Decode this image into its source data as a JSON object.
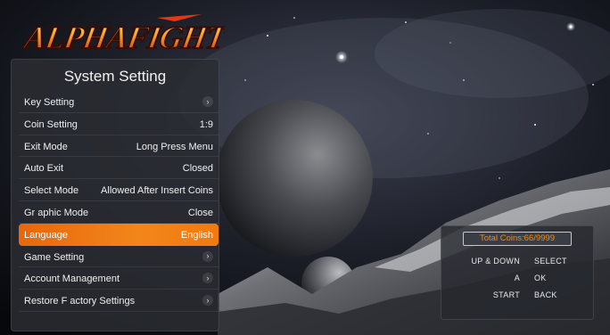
{
  "logo": {
    "text": "ALPHAFIGHT"
  },
  "panel": {
    "title": "System Setting",
    "items": [
      {
        "label": "Key Setting",
        "value": "",
        "arrow": true,
        "active": false
      },
      {
        "label": "Coin Setting",
        "value": "1:9",
        "arrow": false,
        "active": false
      },
      {
        "label": "Exit Mode",
        "value": "Long Press Menu",
        "arrow": false,
        "active": false
      },
      {
        "label": "Auto Exit",
        "value": "Closed",
        "arrow": false,
        "active": false
      },
      {
        "label": "Select Mode",
        "value": "Allowed After Insert Coins",
        "arrow": false,
        "active": false
      },
      {
        "label": "Gr aphic Mode",
        "value": "Close",
        "arrow": false,
        "active": false
      },
      {
        "label": "Language",
        "value": "English",
        "arrow": false,
        "active": true
      },
      {
        "label": "Game Setting",
        "value": "",
        "arrow": true,
        "active": false
      },
      {
        "label": "Account Management",
        "value": "",
        "arrow": true,
        "active": false
      },
      {
        "label": "Restore F actory Settings",
        "value": "",
        "arrow": true,
        "active": false
      }
    ]
  },
  "info": {
    "coins": "Total Coins:66/9999",
    "keys": [
      {
        "key": "UP & DOWN",
        "action": "SELECT"
      },
      {
        "key": "A",
        "action": "OK"
      },
      {
        "key": "START",
        "action": "BACK"
      }
    ]
  },
  "colors": {
    "accent": "#f0801a",
    "panel": "#2a2c32",
    "coins_text": "#f08a1a"
  },
  "icons": {
    "chevron": "chevron-right-icon"
  }
}
